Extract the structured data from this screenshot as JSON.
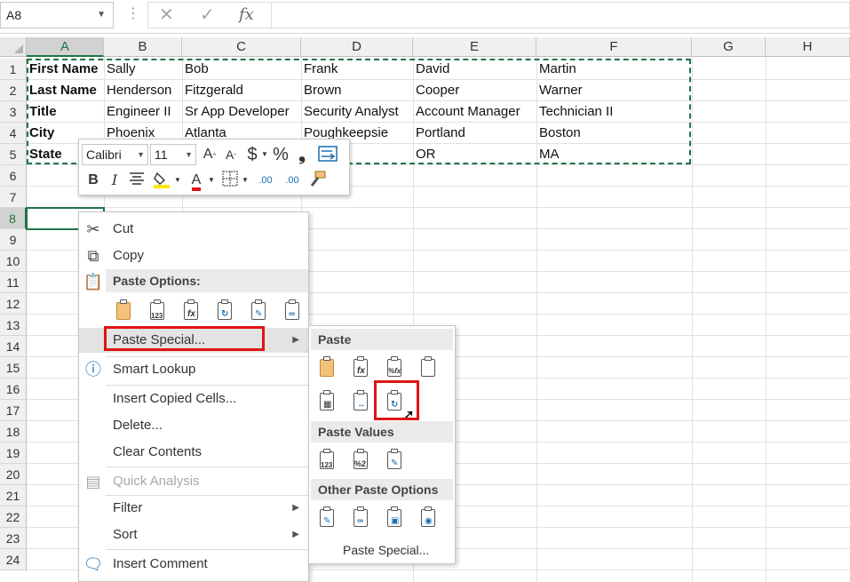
{
  "formula_bar": {
    "name_box": "A8",
    "cancel_glyph": "✕",
    "enter_glyph": "✓",
    "fx_glyph": "fx",
    "formula_value": ""
  },
  "columns": [
    "A",
    "B",
    "C",
    "D",
    "E",
    "F",
    "G",
    "H"
  ],
  "rows": [
    "1",
    "2",
    "3",
    "4",
    "5",
    "6",
    "7",
    "8",
    "9",
    "10",
    "11",
    "12",
    "13",
    "14",
    "15",
    "16",
    "17",
    "18",
    "19",
    "20",
    "21",
    "22",
    "23",
    "24"
  ],
  "cells": {
    "row1": [
      "First Name",
      "Sally",
      "Bob",
      "Frank",
      "David",
      "Martin"
    ],
    "row2": [
      "Last Name",
      "Henderson",
      "Fitzgerald",
      "Brown",
      "Cooper",
      "Warner"
    ],
    "row3": [
      "Title",
      "Engineer II",
      "Sr App Developer",
      "Security Analyst",
      "Account Manager",
      "Technician II"
    ],
    "row4": [
      "City",
      "Phoenix",
      "Atlanta",
      "Poughkeepsie",
      "Portland",
      "Boston"
    ],
    "row5": [
      "State",
      "OR",
      "MA"
    ]
  },
  "mini_toolbar": {
    "font": "Calibri",
    "size": "11",
    "grow_font": "A",
    "shrink_font": "A",
    "currency": "$",
    "percent": "%",
    "comma": "❟",
    "bold": "B",
    "italic": "I",
    "font_color_letter": "A",
    "dec_increase": ".00",
    "dec_decrease": ".00"
  },
  "context_menu": {
    "cut": "Cut",
    "copy": "Copy",
    "paste_options_header": "Paste Options:",
    "paste_special": "Paste Special...",
    "smart_lookup": "Smart Lookup",
    "insert_copied_cells": "Insert Copied Cells...",
    "delete": "Delete...",
    "clear_contents": "Clear Contents",
    "quick_analysis": "Quick Analysis",
    "filter": "Filter",
    "sort": "Sort",
    "insert_comment": "Insert Comment",
    "paste_icon_marks": [
      "",
      "123",
      "fx",
      "",
      "",
      ""
    ]
  },
  "submenu": {
    "paste_header": "Paste",
    "paste_values_header": "Paste Values",
    "other_header": "Other Paste Options",
    "paste_special_link": "Paste Special...",
    "paste_icon_marks": [
      "",
      "fx",
      "%fx",
      ""
    ],
    "paste_row2_marks": [
      "",
      "",
      ""
    ],
    "values_marks": [
      "123",
      "%2",
      ""
    ],
    "other_marks": [
      "",
      "",
      "",
      ""
    ]
  },
  "colors": {
    "excel_green": "#217346",
    "highlight_red": "#e01414"
  }
}
